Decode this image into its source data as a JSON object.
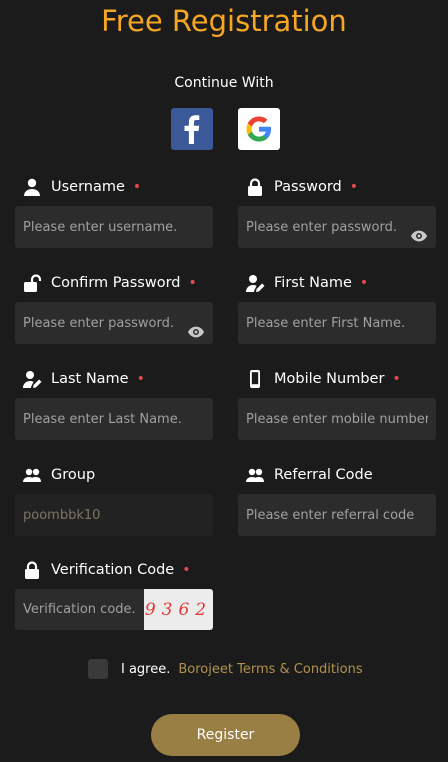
{
  "header": {
    "title": "Free Registration",
    "continue_with": "Continue With"
  },
  "social": [
    {
      "name": "facebook",
      "icon": "facebook-icon",
      "color": "#3b5998"
    },
    {
      "name": "google",
      "icon": "google-icon",
      "color": "#ffffff"
    }
  ],
  "fields": {
    "username": {
      "label": "Username",
      "placeholder": "Please enter username.",
      "required": "•",
      "icon": "user-icon"
    },
    "password": {
      "label": "Password",
      "placeholder": "Please enter password.",
      "required": "•",
      "icon": "lock-icon"
    },
    "confirm_password": {
      "label": "Confirm Password",
      "placeholder": "Please enter password.",
      "required": "•",
      "icon": "unlock-icon"
    },
    "first_name": {
      "label": "First Name",
      "placeholder": "Please enter First Name.",
      "required": "•",
      "icon": "user-edit-icon"
    },
    "last_name": {
      "label": "Last Name",
      "placeholder": "Please enter Last Name.",
      "required": "•",
      "icon": "user-edit-icon"
    },
    "mobile": {
      "label": "Mobile Number",
      "placeholder": "Please enter mobile number.",
      "required": "•",
      "icon": "phone-icon"
    },
    "group": {
      "label": "Group",
      "value": "poombbk10",
      "icon": "users-icon"
    },
    "referral": {
      "label": "Referral Code",
      "placeholder": "Please enter referral code",
      "icon": "users-icon"
    },
    "verification": {
      "label": "Verification Code",
      "placeholder": "Verification code.",
      "required": "•",
      "captcha": "9362",
      "icon": "lock-icon"
    }
  },
  "agree": {
    "text": "I agree.",
    "terms": "Borojeet Terms & Conditions"
  },
  "register": {
    "label": "Register"
  },
  "colors": {
    "accent": "#f5a623",
    "button": "#9a7f45",
    "required": "#e5484d",
    "terms": "#b0924d"
  }
}
